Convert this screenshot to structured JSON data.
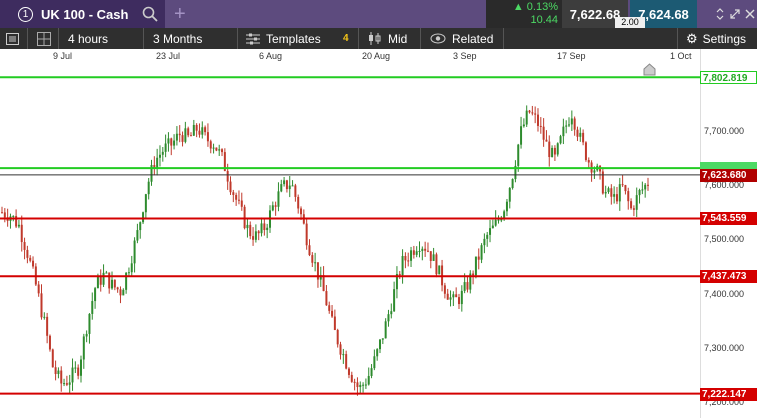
{
  "header": {
    "tab_number": "1",
    "instrument": "UK 100 - Cash",
    "change_pct": "0.13%",
    "change_points": "10.44",
    "sell_price": "7,622.68",
    "buy_price": "7,624.68",
    "spread": "2.00"
  },
  "toolbar": {
    "interval": "4 hours",
    "range": "3 Months",
    "templates_label": "Templates",
    "templates_count": "4",
    "price_type": "Mid",
    "related_label": "Related",
    "settings_label": "Settings"
  },
  "colors": {
    "header_bg": "#5d4b7e",
    "tab_bg": "#3e2c5f",
    "up_candle": "#2e8b2e",
    "down_candle": "#c0392b",
    "support_line": "#d40000",
    "resistance_line": "#22cc22",
    "current_price_bg": "#b00000",
    "change_text": "#4cd964"
  },
  "chart_data": {
    "type": "candlestick",
    "x_ticks": [
      "9 Jul",
      "23 Jul",
      "6 Aug",
      "20 Aug",
      "3 Sep",
      "17 Sep",
      "1 Oct"
    ],
    "y_ticks": [
      "7,700.000",
      "7,600.000",
      "7,500.000",
      "7,400.000",
      "7,300.000",
      "7,200.000"
    ],
    "ylim": [
      7200,
      7805
    ],
    "horizontal_lines": [
      {
        "label": "7,802.819",
        "value": 7802.819,
        "kind": "resistance"
      },
      {
        "label": "7,636.000",
        "value": 7636.0,
        "kind": "resistance"
      },
      {
        "label": "7,543.559",
        "value": 7543.559,
        "kind": "support"
      },
      {
        "label": "7,437.473",
        "value": 7437.473,
        "kind": "support"
      },
      {
        "label": "7,222.147",
        "value": 7222.147,
        "kind": "support"
      }
    ],
    "current_price": {
      "label": "7,623.680",
      "value": 7623.68
    },
    "close_path": [
      7555,
      7550,
      7530,
      7480,
      7420,
      7350,
      7270,
      7240,
      7250,
      7270,
      7350,
      7420,
      7440,
      7420,
      7410,
      7460,
      7520,
      7600,
      7650,
      7670,
      7680,
      7700,
      7690,
      7710,
      7690,
      7680,
      7650,
      7600,
      7560,
      7520,
      7510,
      7530,
      7570,
      7600,
      7610,
      7560,
      7500,
      7450,
      7400,
      7340,
      7300,
      7260,
      7230,
      7250,
      7290,
      7340,
      7400,
      7460,
      7480,
      7500,
      7490,
      7460,
      7420,
      7390,
      7400,
      7430,
      7470,
      7510,
      7530,
      7560,
      7620,
      7700,
      7740,
      7720,
      7680,
      7650,
      7700,
      7740,
      7690,
      7650,
      7630,
      7590,
      7580,
      7600,
      7560,
      7590,
      7610
    ]
  }
}
